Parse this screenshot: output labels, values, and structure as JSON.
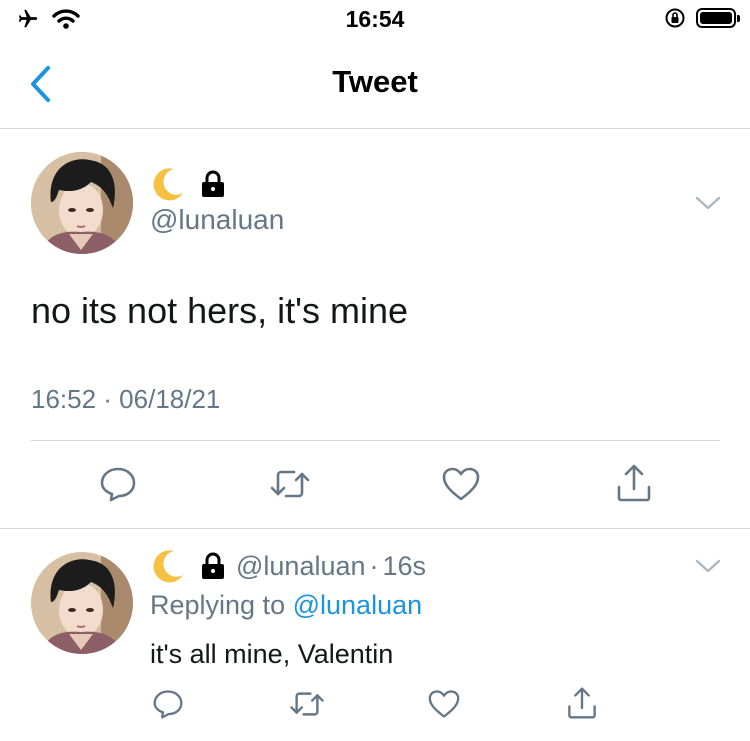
{
  "status_bar": {
    "time": "16:54"
  },
  "nav": {
    "title": "Tweet",
    "back_icon": "chevron-left-icon"
  },
  "main_tweet": {
    "display_name_icons": [
      "crescent-moon-emoji",
      "lock-icon"
    ],
    "handle": "@lunaluan",
    "text": "no its not hers, it's mine",
    "timestamp": "16:52 · 06/18/21",
    "actions": [
      "reply-icon",
      "retweet-icon",
      "like-icon",
      "share-icon"
    ]
  },
  "reply": {
    "handle": "@lunaluan",
    "separator": "·",
    "age": "16s",
    "replying_to_prefix": "Replying to",
    "replying_to_handle": "@lunaluan",
    "text": "it's all mine, Valentin",
    "actions": [
      "reply-icon",
      "retweet-icon",
      "like-icon",
      "share-icon"
    ]
  },
  "colors": {
    "accent": "#1b95e0",
    "secondary_text": "#657786",
    "divider": "#d4d8dc"
  }
}
